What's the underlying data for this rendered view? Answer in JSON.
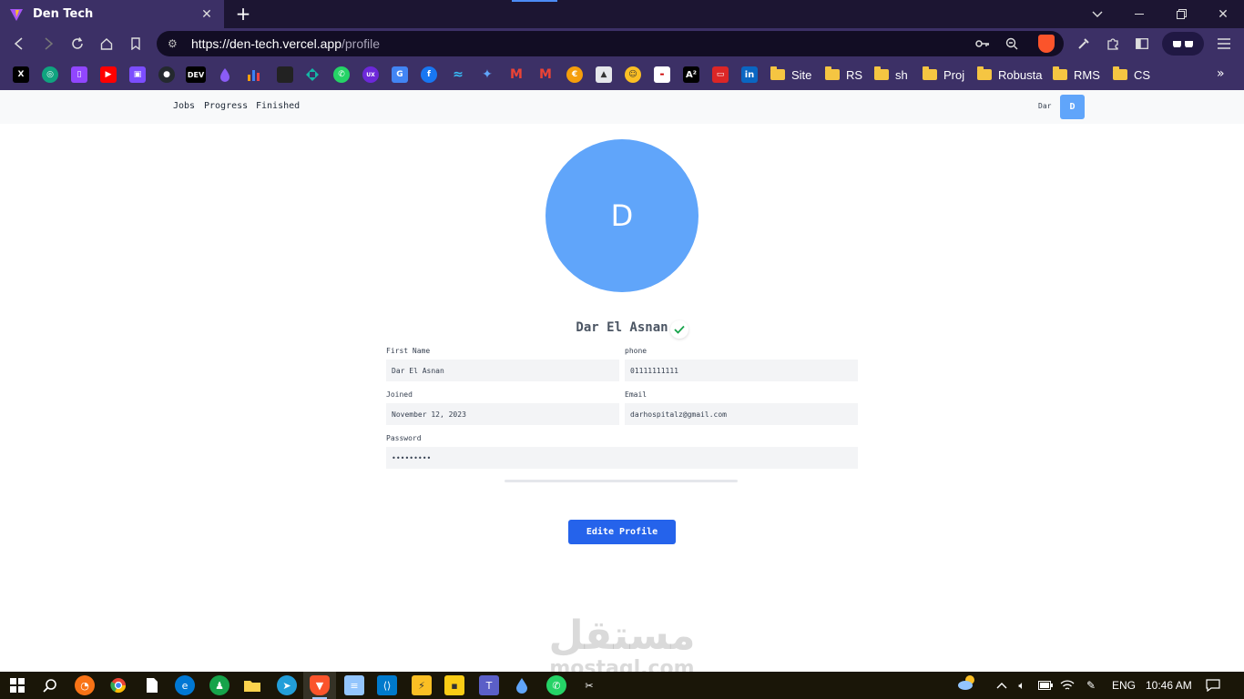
{
  "browser": {
    "tab_title": "Den Tech",
    "url_host": "https://den-tech.vercel.app",
    "url_path": "/profile",
    "bookmarks": {
      "dev_label": "DEV",
      "folders": [
        "Site",
        "RS",
        "sh",
        "Proj",
        "Robusta",
        "RMS",
        "CS"
      ]
    }
  },
  "app": {
    "nav_links": [
      "Jobs",
      "Progress",
      "Finished"
    ],
    "user_short": "Dar",
    "avatar_initial": "D"
  },
  "profile": {
    "avatar_initial": "D",
    "name": "Dar El Asnan",
    "verified": true,
    "fields": {
      "first_name_label": "First Name",
      "first_name": "Dar El Asnan",
      "phone_label": "phone",
      "phone": "01111111111",
      "joined_label": "Joined",
      "joined": "November 12, 2023",
      "email_label": "Email",
      "email": "darhospitalz@gmail.com",
      "password_label": "Password",
      "password": "•••••••••"
    },
    "edit_button": "Edite Profile"
  },
  "watermark": {
    "arabic": "مستقل",
    "latin": "mostaql.com"
  },
  "taskbar": {
    "language": "ENG",
    "time": "10:46 AM"
  },
  "colors": {
    "accent": "#2563eb",
    "avatar": "#60a5fa",
    "browser_chrome": "#3c3066"
  }
}
